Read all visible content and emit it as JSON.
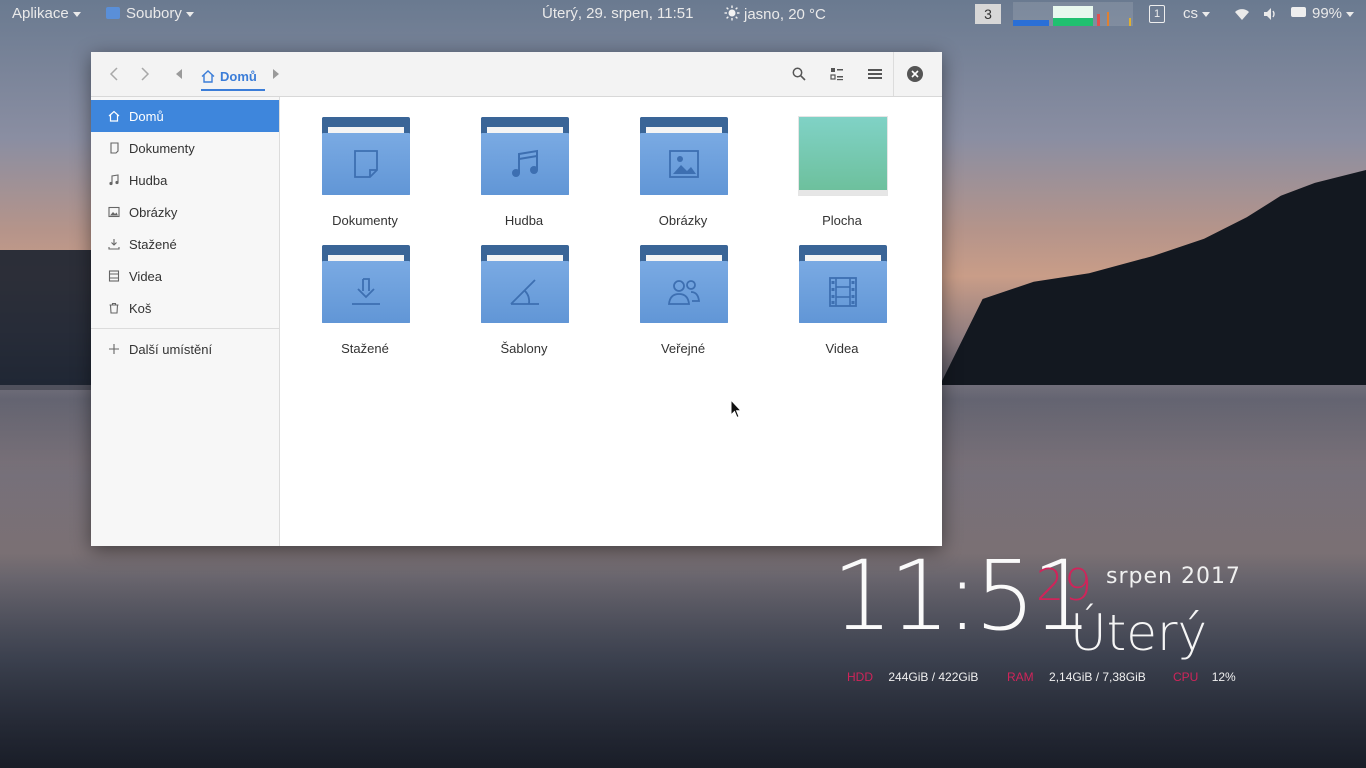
{
  "panel": {
    "apps_menu": "Aplikace",
    "files_menu": "Soubory",
    "datetime": "Úterý, 29. srpen, 11:51",
    "weather": "jasno, 20 °C",
    "workspace": "3",
    "kbd_layout_index": "1",
    "lang": "cs",
    "battery": "99%"
  },
  "window": {
    "breadcrumb": "Domů"
  },
  "sidebar": {
    "items": [
      {
        "label": "Domů",
        "icon": "home-icon",
        "active": true
      },
      {
        "label": "Dokumenty",
        "icon": "document-icon"
      },
      {
        "label": "Hudba",
        "icon": "music-icon"
      },
      {
        "label": "Obrázky",
        "icon": "image-icon"
      },
      {
        "label": "Stažené",
        "icon": "download-icon"
      },
      {
        "label": "Videa",
        "icon": "video-icon"
      },
      {
        "label": "Koš",
        "icon": "trash-icon"
      }
    ],
    "other_locations": "Další umístění"
  },
  "folders": [
    {
      "label": "Dokumenty",
      "icon": "document-icon"
    },
    {
      "label": "Hudba",
      "icon": "music-icon"
    },
    {
      "label": "Obrázky",
      "icon": "image-icon"
    },
    {
      "label": "Plocha",
      "icon": "desktop-thumbnail"
    },
    {
      "label": "Stažené",
      "icon": "download-icon"
    },
    {
      "label": "Šablony",
      "icon": "template-icon"
    },
    {
      "label": "Veřejné",
      "icon": "people-icon"
    },
    {
      "label": "Videa",
      "icon": "video-icon"
    }
  ],
  "conky": {
    "time": "11:51",
    "day": "29",
    "month_year": "srpen 2017",
    "weekday": "Úterý",
    "hdd_label": "HDD",
    "hdd_value": "244GiB / 422GiB",
    "ram_label": "RAM",
    "ram_value": "2,14GiB / 7,38GiB",
    "cpu_label": "CPU",
    "cpu_value": "12%"
  },
  "colors": {
    "accent": "#3e86dc",
    "folder_front": "#6a9fdc",
    "folder_back": "#3a6597",
    "conky_red": "#d0245a"
  }
}
